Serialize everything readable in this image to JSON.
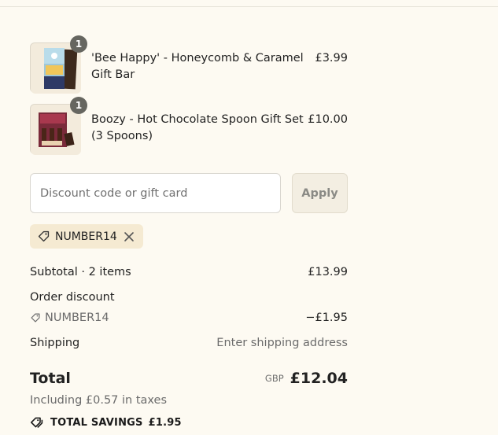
{
  "cart": {
    "items": [
      {
        "title_line1": "'Bee Happy' - Honeycomb & Caramel",
        "title_line2": "Gift Bar",
        "price": "£3.99",
        "quantity": "1",
        "image_icon": "chocolate-bar-product-image"
      },
      {
        "title_line1": "Boozy - Hot Chocolate Spoon Gift Set",
        "title_line2": "(3 Spoons)",
        "price": "£10.00",
        "quantity": "1",
        "image_icon": "gift-box-product-image"
      }
    ]
  },
  "discount": {
    "placeholder": "Discount code or gift card",
    "apply_label": "Apply",
    "applied_code": "NUMBER14"
  },
  "summary": {
    "subtotal_label": "Subtotal · 2 items",
    "subtotal_value": "£13.99",
    "order_discount_label": "Order discount",
    "discount_code": "NUMBER14",
    "discount_value": "−£1.95",
    "shipping_label": "Shipping",
    "shipping_value": "Enter shipping address",
    "total_label": "Total",
    "currency": "GBP",
    "total_value": "£12.04",
    "taxes_note": "Including £0.57 in taxes",
    "savings_label": "TOTAL SAVINGS",
    "savings_value": "£1.95"
  },
  "colors": {
    "page_bg": "#fdfaf2",
    "tag_bg": "#f5ead2",
    "badge": "#666660"
  }
}
